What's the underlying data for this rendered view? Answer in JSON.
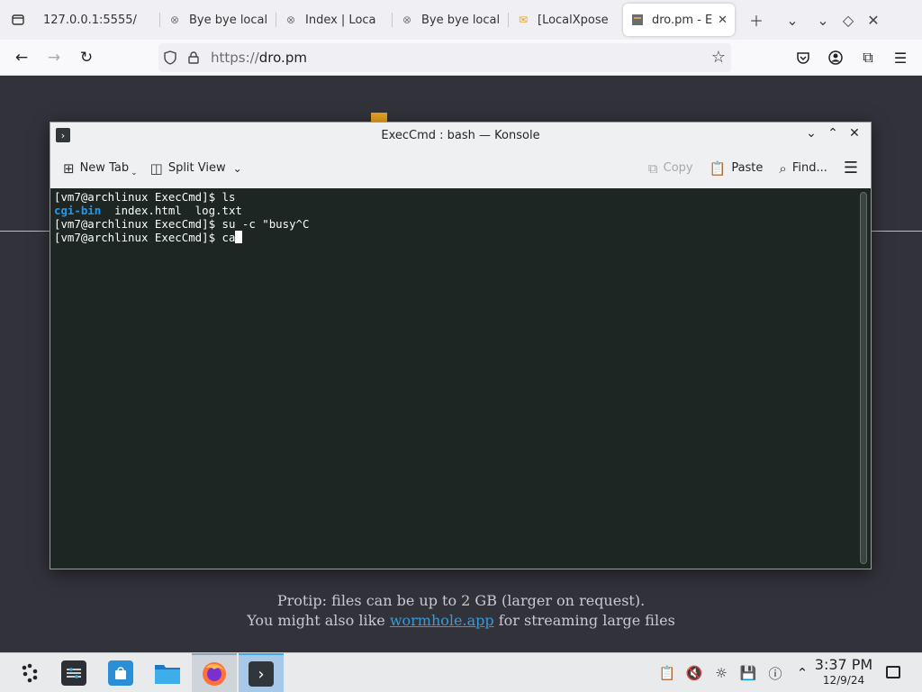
{
  "browser": {
    "tabs": [
      {
        "title": "127.0.0.1:5555/",
        "icon": "none"
      },
      {
        "title": "Bye bye local",
        "icon": "x-circle-icon"
      },
      {
        "title": "Index | Loca",
        "icon": "x-circle-icon"
      },
      {
        "title": "Bye bye local",
        "icon": "x-circle-icon"
      },
      {
        "title": "[LocalXpose",
        "icon": "mail-icon"
      },
      {
        "title": "dro.pm - E",
        "icon": "site-icon",
        "active": true
      }
    ],
    "url_scheme": "https://",
    "url_host": "dro.pm"
  },
  "page": {
    "protip_line1": "Protip: files can be up to 2 GB (larger on request).",
    "protip_prefix": "You might also like ",
    "protip_link": "wormhole.app",
    "protip_suffix": " for streaming large files"
  },
  "konsole": {
    "title": "ExecCmd : bash — Konsole",
    "toolbar": {
      "new_tab": "New Tab",
      "split_view": "Split View",
      "copy": "Copy",
      "paste": "Paste",
      "find": "Find..."
    },
    "terminal": {
      "line1": "[vm7@archlinux ExecCmd]$ ls",
      "line2_dir": "cgi-bin",
      "line2_rest": "  index.html  log.txt",
      "line3": "[vm7@archlinux ExecCmd]$ su -c \"busy^C",
      "line4": "[vm7@archlinux ExecCmd]$ ca"
    }
  },
  "taskbar": {
    "clock_time": "3:37 PM",
    "clock_date": "12/9/24"
  },
  "colors": {
    "terminal_bg": "#1d2622",
    "directory": "#1d99f3",
    "link": "#3a9ad6",
    "accent": "#3daee9"
  }
}
